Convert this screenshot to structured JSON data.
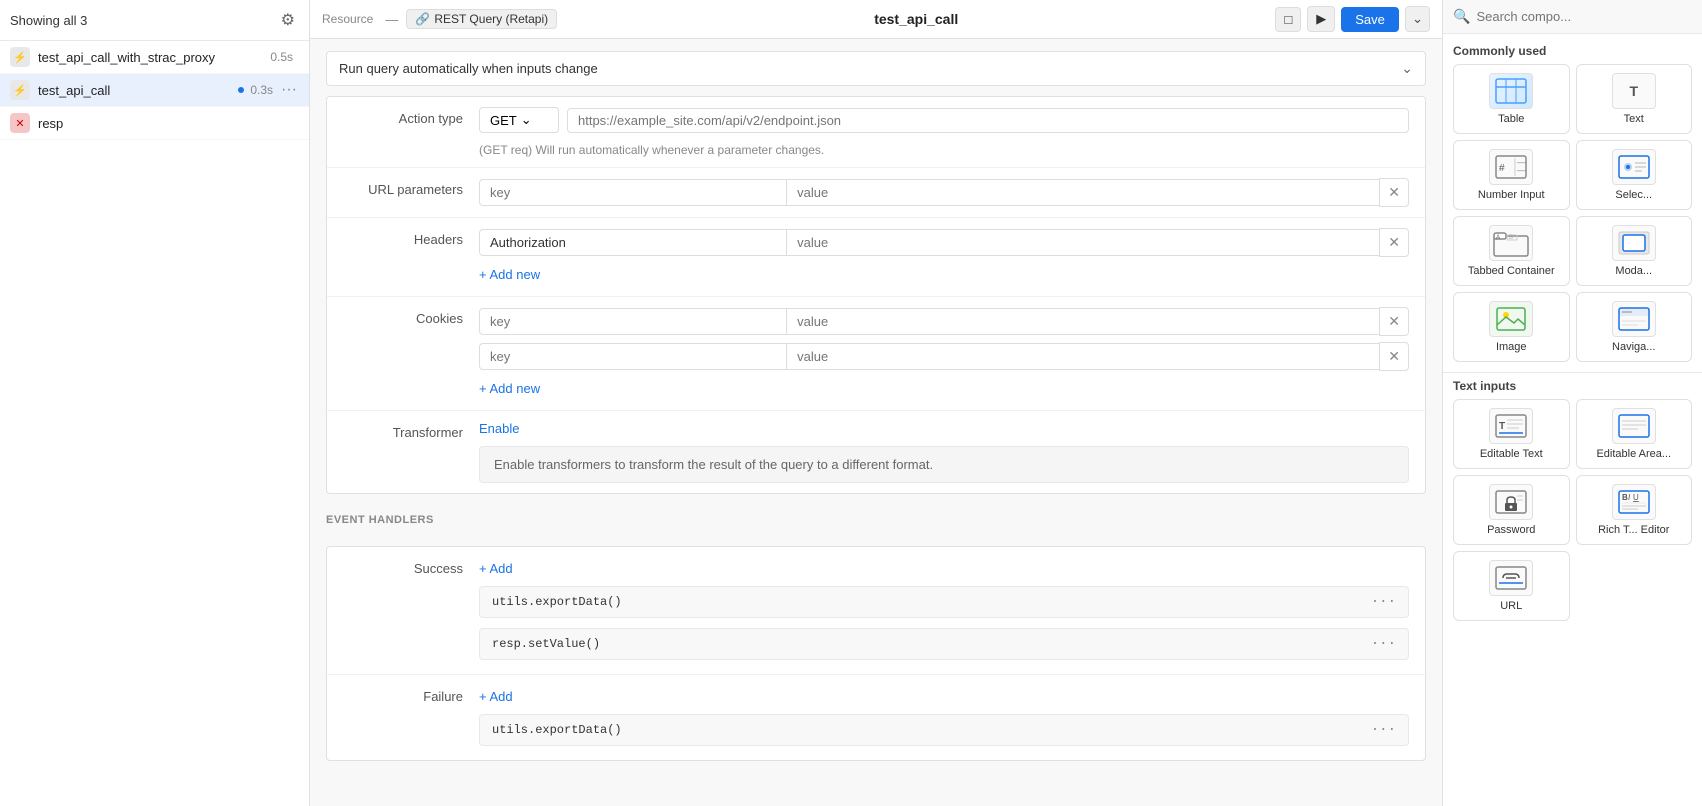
{
  "sidebar": {
    "showing_label": "Showing all 3",
    "items": [
      {
        "id": "test_api_call_with_strac_proxy",
        "name": "test_api_call_with_strac_proxy",
        "time": "0.5s",
        "icon": "lightning",
        "active": false,
        "has_dot": false
      },
      {
        "id": "test_api_call",
        "name": "test_api_call",
        "time": "0.3s",
        "icon": "lightning",
        "active": true,
        "has_dot": true
      },
      {
        "id": "resp",
        "name": "resp",
        "time": "",
        "icon": "x",
        "active": false,
        "has_dot": false
      }
    ]
  },
  "topbar": {
    "resource_label": "Resource",
    "resource_tag": "REST Query (Retapi)",
    "api_title": "test_api_call",
    "save_button": "Save",
    "chevron": "⌄"
  },
  "form": {
    "run_query_label": "Run query automatically when inputs change",
    "action_type_label": "Action type",
    "action_type_value": "GET",
    "url_placeholder": "https://example_site.com/api/v2/endpoint.json",
    "hint_text": "(GET req) Will run automatically whenever a parameter changes.",
    "url_params_label": "URL parameters",
    "url_params_key_placeholder": "key",
    "url_params_value_placeholder": "value",
    "headers_label": "Headers",
    "headers_key_value": "Authorization",
    "headers_value_placeholder": "value",
    "cookies_label": "Cookies",
    "cookies_rows": [
      {
        "key": "key",
        "value": "value"
      },
      {
        "key": "key",
        "value": "value"
      }
    ],
    "add_new_label": "+ Add new",
    "transformer_label": "Transformer",
    "enable_label": "Enable",
    "transformer_hint": "Enable transformers to transform the result of the query to a different format.",
    "event_handlers_title": "EVENT HANDLERS",
    "success_label": "Success",
    "add_label": "+ Add",
    "success_handlers": [
      "utils.exportData()",
      "resp.setValue()"
    ],
    "failure_label": "Failure",
    "failure_handlers": [
      "utils.exportData()"
    ]
  },
  "right_sidebar": {
    "search_placeholder": "Search compo...",
    "commonly_used_label": "Commonly used",
    "components": [
      {
        "id": "table",
        "label": "Table",
        "icon": "table"
      },
      {
        "id": "text",
        "label": "Text",
        "icon": "text"
      },
      {
        "id": "number-input",
        "label": "Number Input",
        "icon": "number"
      },
      {
        "id": "select",
        "label": "Selec...",
        "icon": "select"
      },
      {
        "id": "tabbed-container",
        "label": "Tabbed Container",
        "icon": "tabs"
      },
      {
        "id": "modal",
        "label": "Moda...",
        "icon": "modal"
      },
      {
        "id": "image",
        "label": "Image",
        "icon": "image"
      },
      {
        "id": "navigate",
        "label": "Naviga...",
        "icon": "navigate"
      }
    ],
    "text_inputs_label": "Text inputs",
    "text_inputs": [
      {
        "id": "editable-text",
        "label": "Editable Text",
        "icon": "editable-text"
      },
      {
        "id": "editable-area",
        "label": "Editable Area...",
        "icon": "editable-area"
      },
      {
        "id": "password",
        "label": "Password",
        "icon": "password"
      },
      {
        "id": "rich-text",
        "label": "Rich T... Editor",
        "icon": "rich-text"
      },
      {
        "id": "url",
        "label": "URL",
        "icon": "url"
      }
    ]
  }
}
